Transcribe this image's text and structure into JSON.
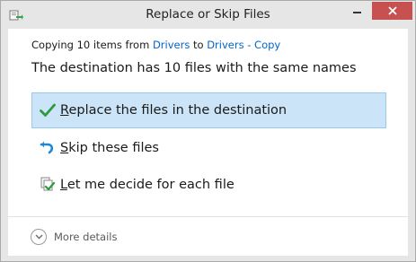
{
  "window": {
    "title": "Replace or Skip Files",
    "close_color": "#c75050"
  },
  "copy_info": {
    "prefix": "Copying 10 items from",
    "source": "Drivers",
    "joiner": "to",
    "destination": "Drivers - Copy"
  },
  "heading": "The destination has 10 files with the same names",
  "options": [
    {
      "label": "Replace the files in the destination",
      "mnemonic": "R",
      "icon": "green-check-icon",
      "selected": true
    },
    {
      "label": "Skip these files",
      "mnemonic": "S",
      "icon": "skip-arrow-icon",
      "selected": false
    },
    {
      "label": "Let me decide for each file",
      "mnemonic": "L",
      "icon": "decide-files-icon",
      "selected": false
    }
  ],
  "more_details": {
    "label": "More details",
    "icon": "chevron-down-circle-icon"
  },
  "colors": {
    "accent_link": "#0066cc",
    "selected_bg": "#cce4f7",
    "selected_border": "#99c9ef"
  }
}
